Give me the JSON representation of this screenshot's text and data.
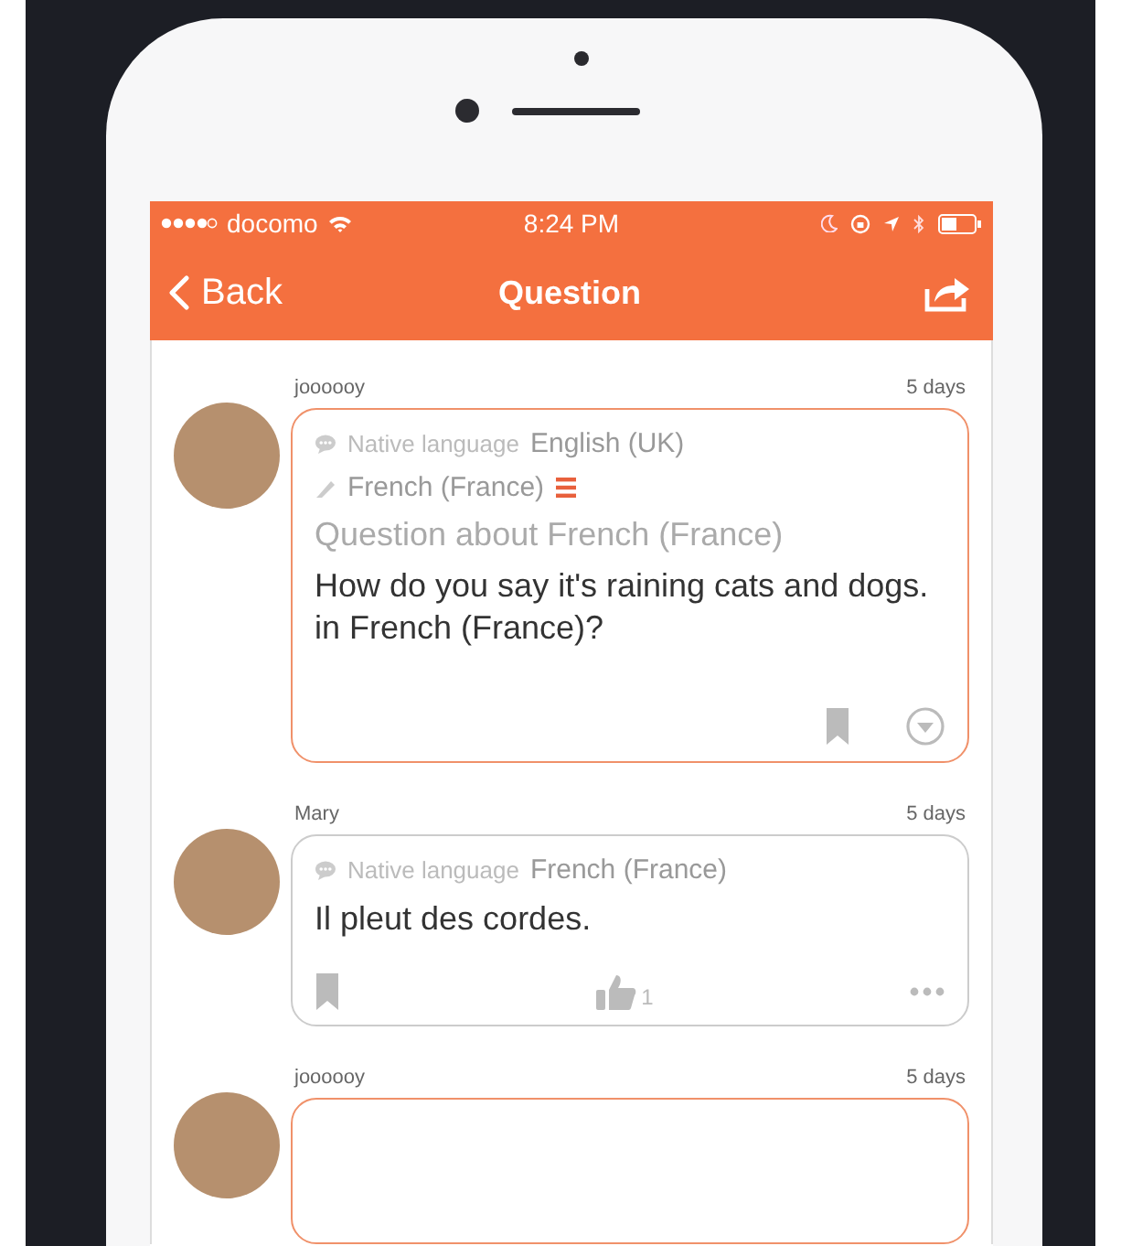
{
  "status_bar": {
    "carrier": "docomo",
    "time": "8:24 PM"
  },
  "nav": {
    "back": "Back",
    "title": "Question"
  },
  "posts": [
    {
      "kind": "question",
      "user": "joooooy",
      "time": "5 days",
      "native_label": "Native language",
      "native_value": "English (UK)",
      "learning": "French (France)",
      "heading": "Question about French (France)",
      "body": "How do you say it's raining cats and dogs.  in French (France)?"
    },
    {
      "kind": "answer",
      "user": "Mary",
      "time": "5 days",
      "native_label": "Native language",
      "native_value": "French (France)",
      "body": "Il pleut des cordes.",
      "likes": "1"
    },
    {
      "kind": "question",
      "user": "joooooy",
      "time": "5 days"
    }
  ]
}
